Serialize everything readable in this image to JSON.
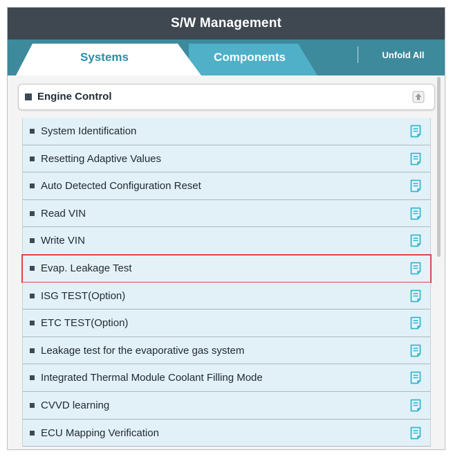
{
  "header": {
    "title": "S/W Management"
  },
  "tabs": {
    "systems_label": "Systems",
    "components_label": "Components",
    "unfold_all_label": "Unfold All",
    "active": "Systems"
  },
  "group": {
    "title": "Engine Control",
    "collapse_icon": "collapse-up-icon"
  },
  "items": [
    {
      "label": "System Identification"
    },
    {
      "label": "Resetting Adaptive Values"
    },
    {
      "label": "Auto Detected Configuration Reset"
    },
    {
      "label": "Read VIN"
    },
    {
      "label": "Write VIN"
    },
    {
      "label": "Evap. Leakage Test"
    },
    {
      "label": "ISG TEST(Option)"
    },
    {
      "label": "ETC TEST(Option)"
    },
    {
      "label": "Leakage test for the evaporative gas system"
    },
    {
      "label": "Integrated Thermal Module Coolant Filling Mode"
    },
    {
      "label": "CVVD learning"
    },
    {
      "label": "ECU Mapping Verification"
    }
  ],
  "selected_item": "Evap. Leakage Test",
  "item_icon": "document-icon",
  "colors": {
    "title_bar": "#3f4850",
    "tab_bar": "#3d8a9d",
    "tab_active_text": "#2b8ea6",
    "item_background": "#e2f1f8",
    "item_icon": "#3ab3cf",
    "selection_border": "#e0454a"
  }
}
